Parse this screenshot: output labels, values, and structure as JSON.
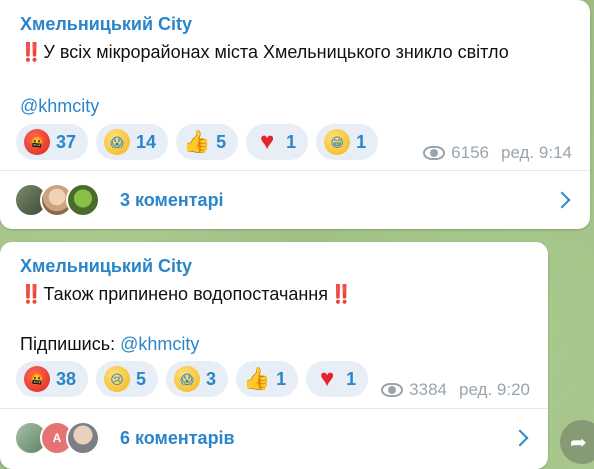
{
  "messages": [
    {
      "author": "Хмельницький City",
      "line1_prefix": "‼️",
      "line1": "У всіх мікрорайонах міста Хмельницького зникло світло",
      "mention": "@khmcity",
      "reactions": [
        {
          "emoji": "angry-face",
          "glyph": "🤬",
          "count": "37"
        },
        {
          "emoji": "screaming-face",
          "glyph": "😱",
          "count": "14"
        },
        {
          "emoji": "thumbs-up",
          "glyph": "👍",
          "count": "5"
        },
        {
          "emoji": "red-heart",
          "glyph": "♥",
          "count": "1"
        },
        {
          "emoji": "grinning-face",
          "glyph": "😁",
          "count": "1"
        }
      ],
      "views": "6156",
      "time": "ред. 9:14",
      "comments_label": "3 коментарі"
    },
    {
      "author": "Хмельницький City",
      "line1_prefix": "‼️",
      "line1": "Також припинено водопостачання",
      "line1_suffix": "‼️",
      "subscribe_label": "Підпишись: ",
      "mention": "@khmcity",
      "reactions": [
        {
          "emoji": "angry-face",
          "glyph": "🤬",
          "count": "38"
        },
        {
          "emoji": "crying-face",
          "glyph": "😢",
          "count": "5"
        },
        {
          "emoji": "screaming-face",
          "glyph": "😱",
          "count": "3"
        },
        {
          "emoji": "thumbs-up",
          "glyph": "👍",
          "count": "1"
        },
        {
          "emoji": "red-heart",
          "glyph": "♥",
          "count": "1"
        }
      ],
      "views": "3384",
      "time": "ред. 9:20",
      "comments_label": "6 коментарів",
      "avatar_letter": "A"
    }
  ],
  "colors": {
    "link": "#2a86c8",
    "reaction_bg": "#e7eef5",
    "meta": "#9aa4ad",
    "alert": "#e0302e"
  }
}
